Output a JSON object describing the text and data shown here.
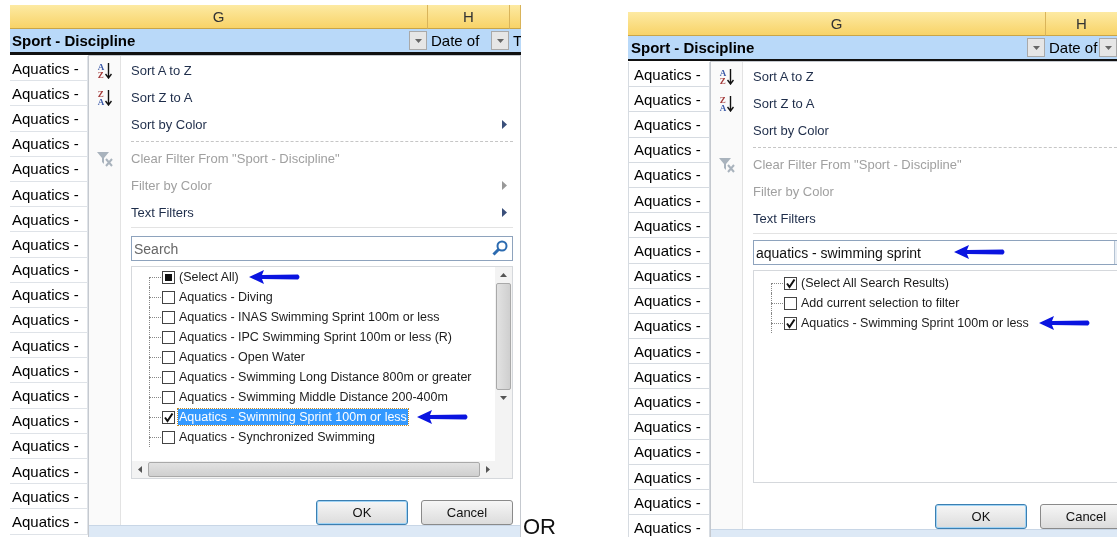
{
  "panels": [
    {
      "column_letters": [
        "G",
        "H"
      ],
      "headers": [
        {
          "label": "Sport - Discipline",
          "filter": true
        },
        {
          "label": "Date of",
          "filter": true
        },
        {
          "label": "T"
        }
      ],
      "cells": [
        "Aquatics -",
        "Aquatics -",
        "Aquatics -",
        "Aquatics -",
        "Aquatics -",
        "Aquatics -",
        "Aquatics -",
        "Aquatics -",
        "Aquatics -",
        "Aquatics -",
        "Aquatics -",
        "Aquatics -",
        "Aquatics -",
        "Aquatics -",
        "Aquatics -",
        "Aquatics -",
        "Aquatics -",
        "Aquatics -",
        "Aquatics -"
      ],
      "menu": {
        "items": [
          {
            "kind": "sort_asc",
            "label": "Sort A to Z",
            "icon_top": "A",
            "icon_bottom": "Z",
            "disabled": false,
            "submenu": false
          },
          {
            "kind": "sort_desc",
            "label": "Sort Z to A",
            "icon_top": "Z",
            "icon_bottom": "A",
            "disabled": false,
            "submenu": false
          },
          {
            "kind": "plain",
            "label": "Sort by Color",
            "disabled": false,
            "submenu": true
          },
          {
            "kind": "dashed_separator"
          },
          {
            "kind": "clear_filter",
            "label": "Clear Filter From \"Sport - Discipline\"",
            "disabled": true,
            "submenu": false
          },
          {
            "kind": "plain",
            "label": "Filter by Color",
            "disabled": true,
            "submenu": true
          },
          {
            "kind": "plain",
            "label": "Text Filters",
            "disabled": false,
            "submenu": true
          },
          {
            "kind": "separator"
          }
        ],
        "search": {
          "placeholder": "Search",
          "kind": "search",
          "arrow": false
        },
        "list": {
          "scrollbars": true,
          "items": [
            {
              "label": "(Select All)",
              "checked": false,
              "indeterminate": true,
              "selected": false,
              "arrow": true
            },
            {
              "label": "Aquatics - Diving",
              "checked": false,
              "indeterminate": false,
              "selected": false,
              "arrow": false
            },
            {
              "label": "Aquatics - INAS Swimming Sprint 100m or less",
              "checked": false,
              "indeterminate": false,
              "selected": false,
              "arrow": false
            },
            {
              "label": "Aquatics - IPC Swimming Sprint 100m or less (R)",
              "checked": false,
              "indeterminate": false,
              "selected": false,
              "arrow": false
            },
            {
              "label": "Aquatics - Open Water",
              "checked": false,
              "indeterminate": false,
              "selected": false,
              "arrow": false
            },
            {
              "label": "Aquatics - Swimming Long Distance 800m or greater",
              "checked": false,
              "indeterminate": false,
              "selected": false,
              "arrow": false
            },
            {
              "label": "Aquatics - Swimming Middle Distance 200-400m",
              "checked": false,
              "indeterminate": false,
              "selected": false,
              "arrow": false
            },
            {
              "label": "Aquatics - Swimming Sprint 100m or less",
              "checked": true,
              "indeterminate": false,
              "selected": true,
              "arrow": true
            },
            {
              "label": "Aquatics - Synchronized Swimming",
              "checked": false,
              "indeterminate": false,
              "selected": false,
              "arrow": false
            }
          ]
        },
        "buttons": [
          {
            "label": "OK",
            "default": true
          },
          {
            "label": "Cancel",
            "default": false
          }
        ]
      }
    },
    {
      "column_letters": [
        "G",
        "H"
      ],
      "headers": [
        {
          "label": "Sport - Discipline",
          "filter": true
        },
        {
          "label": "Date of",
          "filter": true
        }
      ],
      "cells": [
        "Aquatics -",
        "Aquatics -",
        "Aquatics -",
        "Aquatics -",
        "Aquatics -",
        "Aquatics -",
        "Aquatics -",
        "Aquatics -",
        "Aquatics -",
        "Aquatics -",
        "Aquatics -",
        "Aquatics -",
        "Aquatics -",
        "Aquatics -",
        "Aquatics -",
        "Aquatics -",
        "Aquatics -",
        "Aquatics -",
        "Aquatics -"
      ],
      "menu": {
        "items": [
          {
            "kind": "sort_asc",
            "label": "Sort A to Z",
            "icon_top": "A",
            "icon_bottom": "Z",
            "disabled": false
          },
          {
            "kind": "sort_desc",
            "label": "Sort Z to A",
            "icon_top": "Z",
            "icon_bottom": "A",
            "disabled": false
          },
          {
            "kind": "plain",
            "label": "Sort by Color",
            "disabled": false
          },
          {
            "kind": "dashed_separator"
          },
          {
            "kind": "clear_filter",
            "label": "Clear Filter From \"Sport - Discipline\"",
            "disabled": true
          },
          {
            "kind": "plain",
            "label": "Filter by Color",
            "disabled": true
          },
          {
            "kind": "plain",
            "label": "Text Filters",
            "disabled": false
          },
          {
            "kind": "separator"
          }
        ],
        "search": {
          "value": "aquatics - swimming sprint",
          "kind": "clear",
          "arrow": true
        },
        "list": {
          "scrollbars": false,
          "items": [
            {
              "label": "(Select All Search Results)",
              "checked": true,
              "selected": false,
              "arrow": false
            },
            {
              "label": "Add current selection to filter",
              "checked": false,
              "selected": false,
              "arrow": false
            },
            {
              "label": "Aquatics - Swimming Sprint 100m or less",
              "checked": true,
              "selected": false,
              "arrow": true
            }
          ]
        },
        "buttons": [
          {
            "label": "OK",
            "default": true
          },
          {
            "label": "Cancel",
            "default": false
          }
        ]
      }
    }
  ],
  "divider_text": "OR"
}
